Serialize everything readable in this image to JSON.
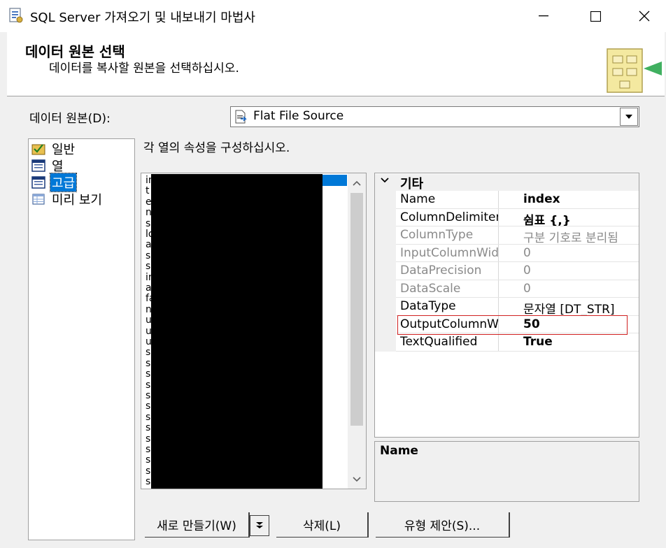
{
  "window": {
    "title": "SQL Server 가져오기 및 내보내기 마법사",
    "minimize_glyph": "—",
    "maximize_glyph": "☐",
    "close_glyph": "✕"
  },
  "header": {
    "title": "데이터 원본 선택",
    "subtitle": "데이터를 복사할 원본을 선택하십시오."
  },
  "datasource": {
    "label": "데이터 원본(D):",
    "value": "Flat File Source",
    "icon": "flat-file-icon"
  },
  "nav": {
    "items": [
      {
        "label": "일반",
        "icon": "general-icon",
        "selected": false
      },
      {
        "label": "열",
        "icon": "columns-icon",
        "selected": false
      },
      {
        "label": "고급",
        "icon": "advanced-icon",
        "selected": true
      },
      {
        "label": "미리 보기",
        "icon": "preview-icon",
        "selected": false
      }
    ]
  },
  "description": "각 열의 속성을 구성하십시오.",
  "column_list": {
    "visible_initials": [
      "in",
      "t",
      "e",
      "n",
      "s",
      "lo",
      "a",
      "s",
      "s",
      "in",
      "a",
      "fa",
      "n",
      "u",
      "u",
      "u",
      "s",
      "s",
      "s",
      "s",
      "s",
      "s",
      "s",
      "s",
      "s",
      "s",
      "s",
      "s",
      "s"
    ]
  },
  "properties": {
    "category": "기타",
    "rows": [
      {
        "name": "Name",
        "value": "index",
        "dim": false,
        "bold": true
      },
      {
        "name": "ColumnDelimiter",
        "value": "쉼표 {,}",
        "dim": false,
        "bold": true
      },
      {
        "name": "ColumnType",
        "value": "구분 기호로 분리됨",
        "dim": true,
        "bold": false
      },
      {
        "name": "InputColumnWidth",
        "value": "0",
        "dim": true,
        "bold": false
      },
      {
        "name": "DataPrecision",
        "value": "0",
        "dim": true,
        "bold": false
      },
      {
        "name": "DataScale",
        "value": "0",
        "dim": true,
        "bold": false
      },
      {
        "name": "DataType",
        "value": "문자열 [DT_STR]",
        "dim": false,
        "bold": false
      },
      {
        "name": "OutputColumnWidth",
        "value": "50",
        "dim": false,
        "bold": true
      },
      {
        "name": "TextQualified",
        "value": "True",
        "dim": false,
        "bold": true
      }
    ],
    "highlighted_row": "OutputColumnWidth",
    "highlight_color": "#d02020"
  },
  "help": {
    "title": "Name"
  },
  "buttons": {
    "new": "새로 만들기(W)",
    "delete": "삭제(L)",
    "suggest": "유형 제안(S)..."
  },
  "colors": {
    "selection": "#0078d7",
    "background": "#f0f0f0"
  }
}
